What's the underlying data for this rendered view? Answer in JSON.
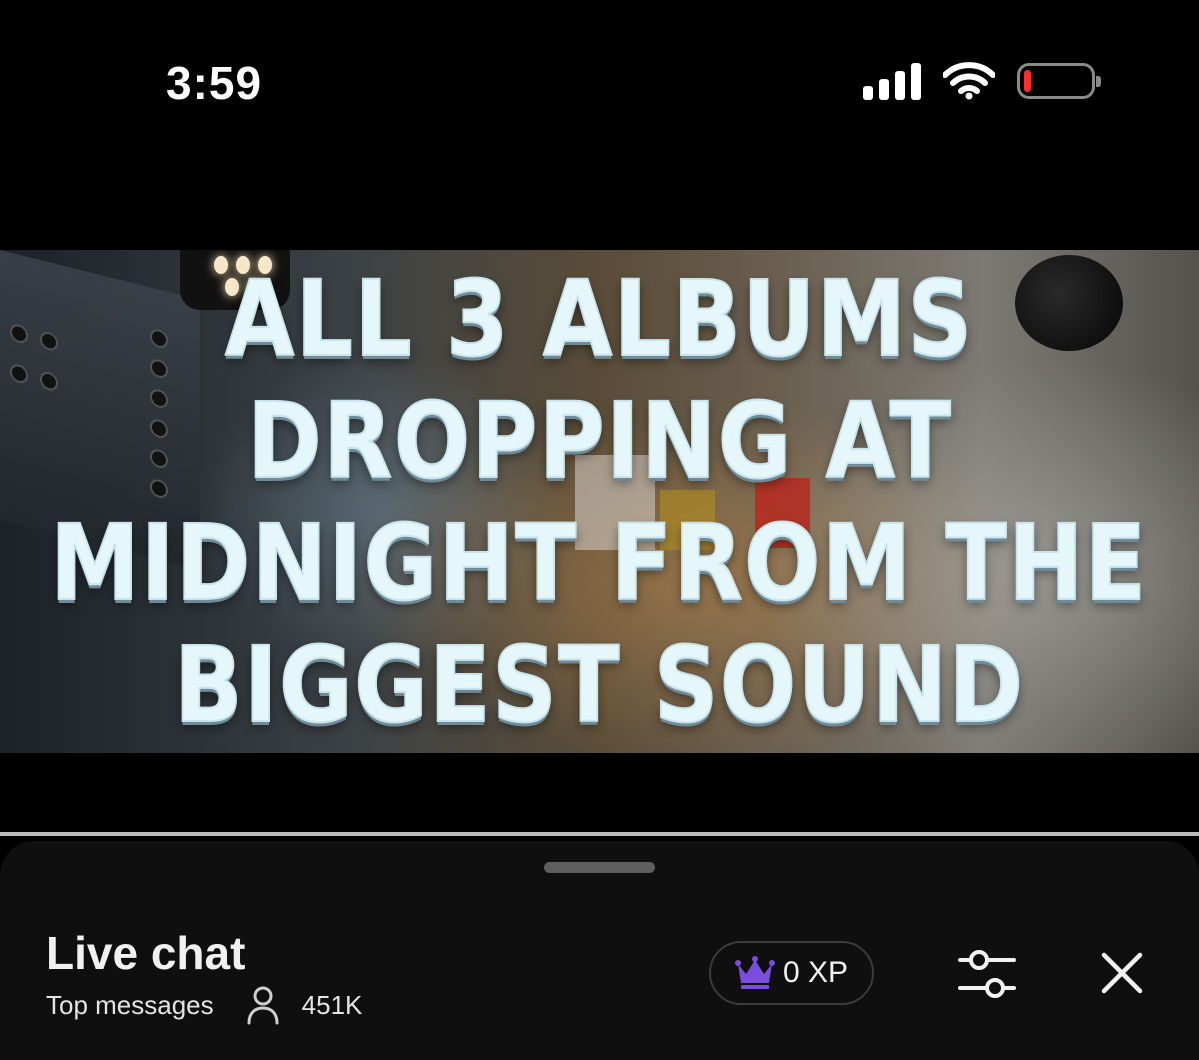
{
  "status_bar": {
    "time": "3:59",
    "icons": [
      "signal-icon",
      "wifi-icon",
      "battery-icon"
    ]
  },
  "video": {
    "caption_lines": [
      "ALL 3 ALBUMS",
      "DROPPING AT",
      "MIDNIGHT FROM THE",
      "BIGGEST SOUND"
    ]
  },
  "live_chat": {
    "title": "Live chat",
    "mode_label": "Top messages",
    "viewer_count": "451K",
    "xp_label": "0 XP",
    "icons": {
      "viewers": "person-icon",
      "xp": "crown-icon",
      "filter": "sliders-icon",
      "close": "close-icon"
    },
    "colors": {
      "crown": "#7b4dde",
      "panel_bg": "#0f0f0f"
    }
  }
}
